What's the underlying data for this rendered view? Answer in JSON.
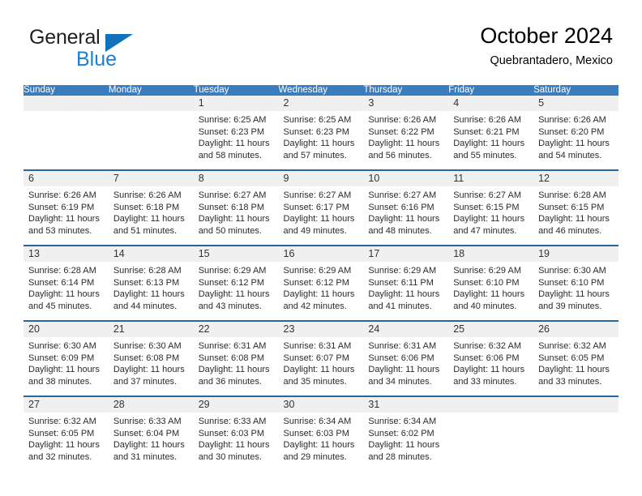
{
  "brand": {
    "name_top": "General",
    "name_bottom": "Blue",
    "triangle_color": "#1271bb",
    "blue_color": "#1a7fd4"
  },
  "header": {
    "title": "October 2024",
    "subtitle": "Quebrantadero, Mexico"
  },
  "colors": {
    "header_blue": "#3a7cbe",
    "row_divider_blue": "#2a659f",
    "datebar_gray": "#f0f0f0",
    "text": "#2b2b2b"
  },
  "weekdays": [
    "Sunday",
    "Monday",
    "Tuesday",
    "Wednesday",
    "Thursday",
    "Friday",
    "Saturday"
  ],
  "labels": {
    "sunrise_prefix": "Sunrise:",
    "sunset_prefix": "Sunset:",
    "daylight_prefix": "Daylight:"
  },
  "weeks": [
    [
      {
        "day": "",
        "lines": []
      },
      {
        "day": "",
        "lines": []
      },
      {
        "day": "1",
        "lines": [
          "Sunrise: 6:25 AM",
          "Sunset: 6:23 PM",
          "Daylight: 11 hours",
          "and 58 minutes."
        ]
      },
      {
        "day": "2",
        "lines": [
          "Sunrise: 6:25 AM",
          "Sunset: 6:23 PM",
          "Daylight: 11 hours",
          "and 57 minutes."
        ]
      },
      {
        "day": "3",
        "lines": [
          "Sunrise: 6:26 AM",
          "Sunset: 6:22 PM",
          "Daylight: 11 hours",
          "and 56 minutes."
        ]
      },
      {
        "day": "4",
        "lines": [
          "Sunrise: 6:26 AM",
          "Sunset: 6:21 PM",
          "Daylight: 11 hours",
          "and 55 minutes."
        ]
      },
      {
        "day": "5",
        "lines": [
          "Sunrise: 6:26 AM",
          "Sunset: 6:20 PM",
          "Daylight: 11 hours",
          "and 54 minutes."
        ]
      }
    ],
    [
      {
        "day": "6",
        "lines": [
          "Sunrise: 6:26 AM",
          "Sunset: 6:19 PM",
          "Daylight: 11 hours",
          "and 53 minutes."
        ]
      },
      {
        "day": "7",
        "lines": [
          "Sunrise: 6:26 AM",
          "Sunset: 6:18 PM",
          "Daylight: 11 hours",
          "and 51 minutes."
        ]
      },
      {
        "day": "8",
        "lines": [
          "Sunrise: 6:27 AM",
          "Sunset: 6:18 PM",
          "Daylight: 11 hours",
          "and 50 minutes."
        ]
      },
      {
        "day": "9",
        "lines": [
          "Sunrise: 6:27 AM",
          "Sunset: 6:17 PM",
          "Daylight: 11 hours",
          "and 49 minutes."
        ]
      },
      {
        "day": "10",
        "lines": [
          "Sunrise: 6:27 AM",
          "Sunset: 6:16 PM",
          "Daylight: 11 hours",
          "and 48 minutes."
        ]
      },
      {
        "day": "11",
        "lines": [
          "Sunrise: 6:27 AM",
          "Sunset: 6:15 PM",
          "Daylight: 11 hours",
          "and 47 minutes."
        ]
      },
      {
        "day": "12",
        "lines": [
          "Sunrise: 6:28 AM",
          "Sunset: 6:15 PM",
          "Daylight: 11 hours",
          "and 46 minutes."
        ]
      }
    ],
    [
      {
        "day": "13",
        "lines": [
          "Sunrise: 6:28 AM",
          "Sunset: 6:14 PM",
          "Daylight: 11 hours",
          "and 45 minutes."
        ]
      },
      {
        "day": "14",
        "lines": [
          "Sunrise: 6:28 AM",
          "Sunset: 6:13 PM",
          "Daylight: 11 hours",
          "and 44 minutes."
        ]
      },
      {
        "day": "15",
        "lines": [
          "Sunrise: 6:29 AM",
          "Sunset: 6:12 PM",
          "Daylight: 11 hours",
          "and 43 minutes."
        ]
      },
      {
        "day": "16",
        "lines": [
          "Sunrise: 6:29 AM",
          "Sunset: 6:12 PM",
          "Daylight: 11 hours",
          "and 42 minutes."
        ]
      },
      {
        "day": "17",
        "lines": [
          "Sunrise: 6:29 AM",
          "Sunset: 6:11 PM",
          "Daylight: 11 hours",
          "and 41 minutes."
        ]
      },
      {
        "day": "18",
        "lines": [
          "Sunrise: 6:29 AM",
          "Sunset: 6:10 PM",
          "Daylight: 11 hours",
          "and 40 minutes."
        ]
      },
      {
        "day": "19",
        "lines": [
          "Sunrise: 6:30 AM",
          "Sunset: 6:10 PM",
          "Daylight: 11 hours",
          "and 39 minutes."
        ]
      }
    ],
    [
      {
        "day": "20",
        "lines": [
          "Sunrise: 6:30 AM",
          "Sunset: 6:09 PM",
          "Daylight: 11 hours",
          "and 38 minutes."
        ]
      },
      {
        "day": "21",
        "lines": [
          "Sunrise: 6:30 AM",
          "Sunset: 6:08 PM",
          "Daylight: 11 hours",
          "and 37 minutes."
        ]
      },
      {
        "day": "22",
        "lines": [
          "Sunrise: 6:31 AM",
          "Sunset: 6:08 PM",
          "Daylight: 11 hours",
          "and 36 minutes."
        ]
      },
      {
        "day": "23",
        "lines": [
          "Sunrise: 6:31 AM",
          "Sunset: 6:07 PM",
          "Daylight: 11 hours",
          "and 35 minutes."
        ]
      },
      {
        "day": "24",
        "lines": [
          "Sunrise: 6:31 AM",
          "Sunset: 6:06 PM",
          "Daylight: 11 hours",
          "and 34 minutes."
        ]
      },
      {
        "day": "25",
        "lines": [
          "Sunrise: 6:32 AM",
          "Sunset: 6:06 PM",
          "Daylight: 11 hours",
          "and 33 minutes."
        ]
      },
      {
        "day": "26",
        "lines": [
          "Sunrise: 6:32 AM",
          "Sunset: 6:05 PM",
          "Daylight: 11 hours",
          "and 33 minutes."
        ]
      }
    ],
    [
      {
        "day": "27",
        "lines": [
          "Sunrise: 6:32 AM",
          "Sunset: 6:05 PM",
          "Daylight: 11 hours",
          "and 32 minutes."
        ]
      },
      {
        "day": "28",
        "lines": [
          "Sunrise: 6:33 AM",
          "Sunset: 6:04 PM",
          "Daylight: 11 hours",
          "and 31 minutes."
        ]
      },
      {
        "day": "29",
        "lines": [
          "Sunrise: 6:33 AM",
          "Sunset: 6:03 PM",
          "Daylight: 11 hours",
          "and 30 minutes."
        ]
      },
      {
        "day": "30",
        "lines": [
          "Sunrise: 6:34 AM",
          "Sunset: 6:03 PM",
          "Daylight: 11 hours",
          "and 29 minutes."
        ]
      },
      {
        "day": "31",
        "lines": [
          "Sunrise: 6:34 AM",
          "Sunset: 6:02 PM",
          "Daylight: 11 hours",
          "and 28 minutes."
        ]
      },
      {
        "day": "",
        "lines": []
      },
      {
        "day": "",
        "lines": []
      }
    ]
  ]
}
